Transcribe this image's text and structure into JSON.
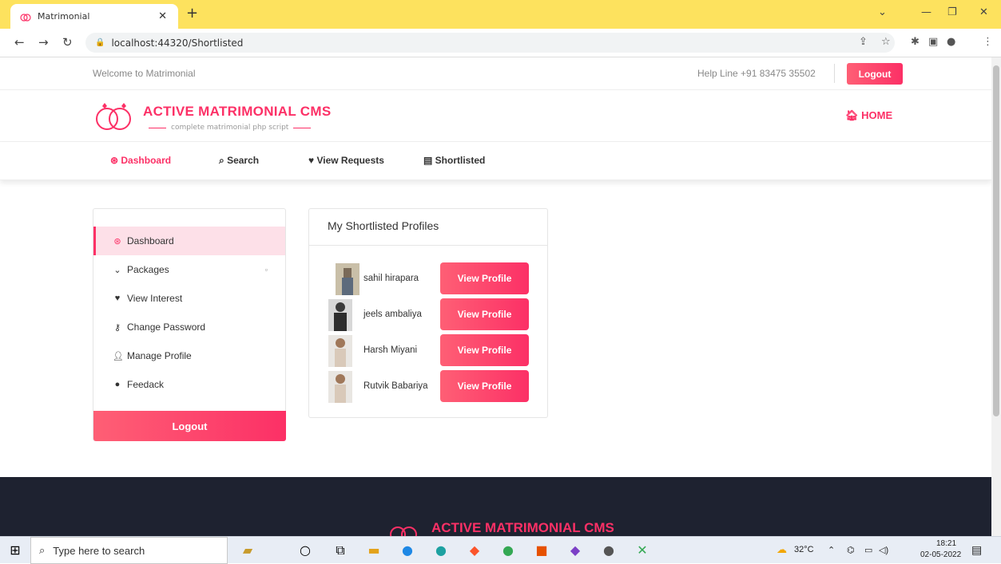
{
  "browser": {
    "tab_title": "Matrimonial",
    "url": "localhost:44320/Shortlisted"
  },
  "topbar": {
    "welcome": "Welcome to Matrimonial",
    "helpline": "Help Line +91 83475 35502",
    "logout": "Logout"
  },
  "brand": {
    "title": "ACTIVE MATRIMONIAL CMS",
    "subtitle": "complete matrimonial php script",
    "home": "HOME"
  },
  "menu": {
    "dashboard": "Dashboard",
    "search": "Search",
    "view_requests": "View Requests",
    "shortlisted": "Shortlisted"
  },
  "sidebar": {
    "items": [
      "Dashboard",
      "Packages",
      "View Interest",
      "Change Password",
      "Manage Profile",
      "Feedack"
    ],
    "logout": "Logout"
  },
  "card": {
    "title": "My Shortlisted Profiles",
    "button_label": "View Profile",
    "profiles": [
      {
        "name": "sahil hirapara"
      },
      {
        "name": "jeels ambaliya"
      },
      {
        "name": "Harsh Miyani"
      },
      {
        "name": "Rutvik Babariya"
      }
    ]
  },
  "footer": {
    "title": "ACTIVE MATRIMONIAL CMS"
  },
  "taskbar": {
    "search_placeholder": "Type here to search",
    "weather": "32°C",
    "time": "18:21",
    "date": "02-05-2022"
  },
  "colors": {
    "accent": "#fc3066",
    "tab_bar": "#fde25e",
    "footer": "#1e2230"
  }
}
